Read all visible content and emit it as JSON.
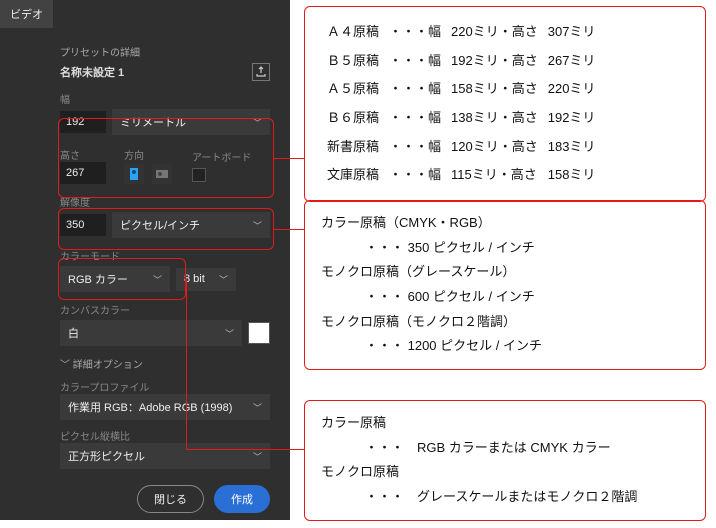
{
  "panel": {
    "tab": "ビデオ",
    "preset_detail_label": "プリセットの詳細",
    "preset_name": "名称未設定 1",
    "width_label": "幅",
    "width_value": "192",
    "unit": "ミリメートル",
    "height_label": "高さ",
    "height_value": "267",
    "orientation_label": "方向",
    "artboard_label": "アートボード",
    "resolution_label": "解像度",
    "resolution_value": "350",
    "resolution_unit": "ピクセル/インチ",
    "color_mode_label": "カラーモード",
    "color_mode": "RGB カラー",
    "bit_depth": "8 bit",
    "canvas_color_label": "カンバスカラー",
    "canvas_color": "白",
    "advanced_label": "詳細オプション",
    "profile_label": "カラープロファイル",
    "profile_value": "作業用 RGB：Adobe RGB (1998)",
    "pixel_ratio_label": "ピクセル縦横比",
    "pixel_ratio_value": "正方形ピクセル",
    "close_btn": "閉じる",
    "create_btn": "作成"
  },
  "sizes": [
    {
      "name": "Ａ４原稿",
      "w": "220",
      "h": "307"
    },
    {
      "name": "Ｂ５原稿",
      "w": "192",
      "h": "267"
    },
    {
      "name": "Ａ５原稿",
      "w": "158",
      "h": "220"
    },
    {
      "name": "Ｂ６原稿",
      "w": "138",
      "h": "192"
    },
    {
      "name": "新書原稿",
      "w": "120",
      "h": "183"
    },
    {
      "name": "文庫原稿",
      "w": "115",
      "h": "158"
    }
  ],
  "dots": "・・・",
  "w_lbl": "幅",
  "h_lbl": "高さ",
  "mm": "ミリ",
  "res_box": {
    "l1": "カラー原稿（CMYK・RGB）",
    "l1v": "・・・ 350 ピクセル / インチ",
    "l2": "モノクロ原稿（グレースケール）",
    "l2v": "・・・ 600 ピクセル / インチ",
    "l3": "モノクロ原稿（モノクロ２階調）",
    "l3v": "・・・ 1200 ピクセル / インチ"
  },
  "mode_box": {
    "l1": "カラー原稿",
    "l1v": "・・・　RGB カラーまたは CMYK カラー",
    "l2": "モノクロ原稿",
    "l2v": "・・・　グレースケールまたはモノクロ２階調"
  }
}
